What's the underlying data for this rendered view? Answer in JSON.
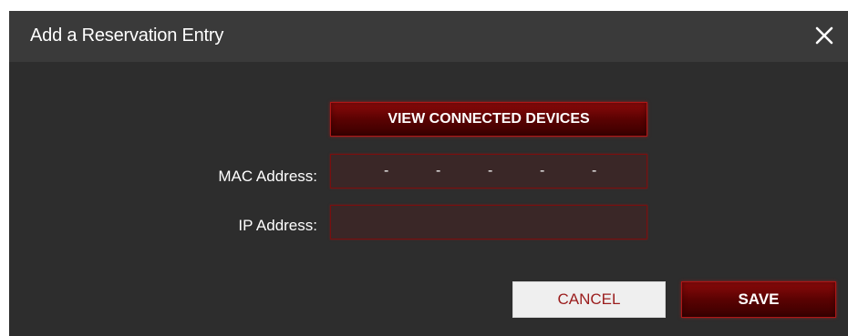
{
  "dialog": {
    "title": "Add a Reservation Entry",
    "close_icon": "close-icon"
  },
  "buttons": {
    "view_connected_devices": "VIEW CONNECTED DEVICES",
    "cancel": "CANCEL",
    "save": "SAVE"
  },
  "fields": {
    "mac_address": {
      "label": "MAC Address:",
      "separators": [
        "-",
        "-",
        "-",
        "-",
        "-"
      ],
      "value": ""
    },
    "ip_address": {
      "label": "IP Address:",
      "value": ""
    }
  },
  "colors": {
    "dialog_background": "#2d2d2d",
    "header_background": "#3a3a3a",
    "accent_red": "#8a0a0a",
    "field_border": "#7a0e0e",
    "cancel_text": "#9b1d1d"
  }
}
